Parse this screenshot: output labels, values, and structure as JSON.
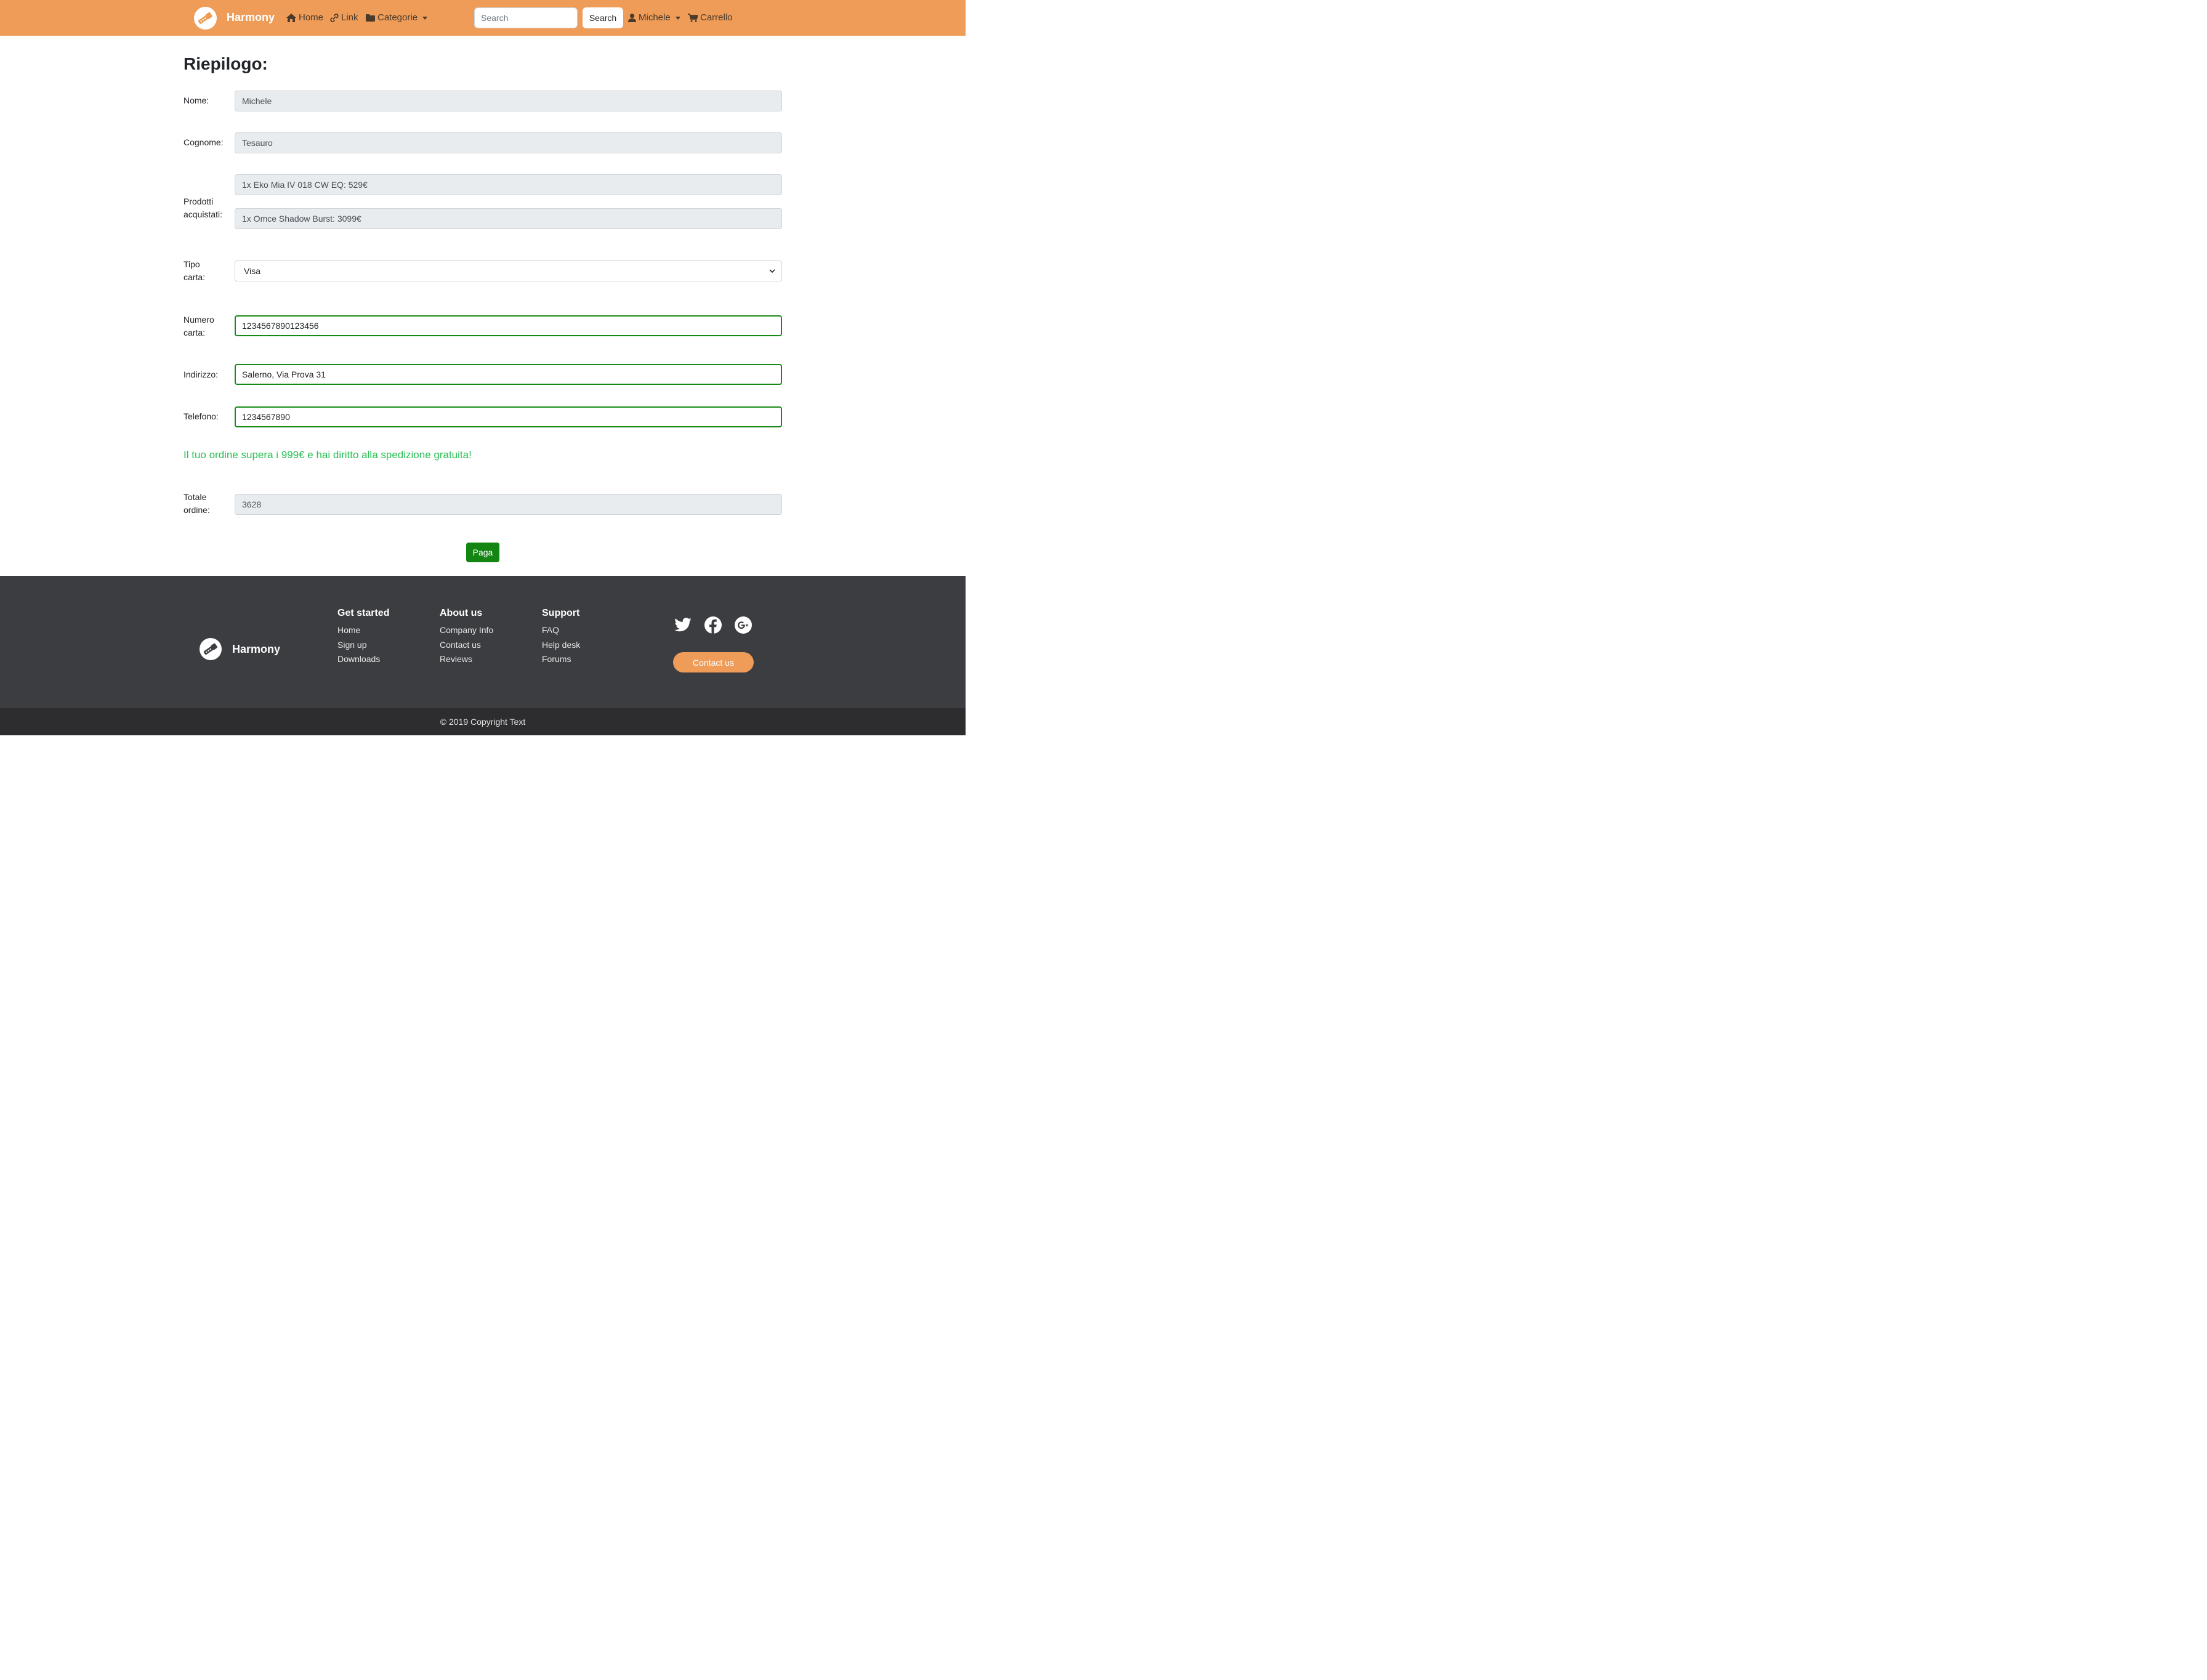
{
  "nav": {
    "brand": "Harmony",
    "home": "Home",
    "link": "Link",
    "categories": "Categorie",
    "search_placeholder": "Search",
    "search_button": "Search",
    "user": "Michele",
    "cart": "Carrello"
  },
  "main": {
    "title": "Riepilogo:",
    "nome_label": "Nome:",
    "nome_value": "Michele",
    "cognome_label": "Cognome:",
    "cognome_value": "Tesauro",
    "prodotti_label": "Prodotti acquistati:",
    "products": [
      "1x Eko Mia IV 018 CW EQ: 529€",
      "1x Omce Shadow Burst: 3099€"
    ],
    "tipo_label": "Tipo carta:",
    "tipo_value": "Visa",
    "numero_label": "Numero carta:",
    "numero_value": "1234567890123456",
    "indirizzo_label": "Indirizzo:",
    "indirizzo_value": "Salerno, Via Prova 31",
    "telefono_label": "Telefono:",
    "telefono_value": "1234567890",
    "promo": "Il tuo ordine supera i 999€ e hai diritto alla spedizione gratuita!",
    "totale_label": "Totale ordine:",
    "totale_value": "3628",
    "pay_button": "Paga"
  },
  "footer": {
    "brand": "Harmony",
    "columns": [
      {
        "title": "Get started",
        "links": [
          "Home",
          "Sign up",
          "Downloads"
        ]
      },
      {
        "title": "About us",
        "links": [
          "Company Info",
          "Contact us",
          "Reviews"
        ]
      },
      {
        "title": "Support",
        "links": [
          "FAQ",
          "Help desk",
          "Forums"
        ]
      }
    ],
    "social_icons": [
      "twitter-icon",
      "facebook-icon",
      "google-plus-icon"
    ],
    "contact_button": "Contact us",
    "copyright": "© 2019 Copyright Text"
  },
  "colors": {
    "navbar": "#ee9c58",
    "footer": "#3c3d41",
    "copyright_bar": "#2d2d2f",
    "valid_border": "#168a16",
    "pay_button": "#128512",
    "promo_text": "#2bbf55"
  }
}
